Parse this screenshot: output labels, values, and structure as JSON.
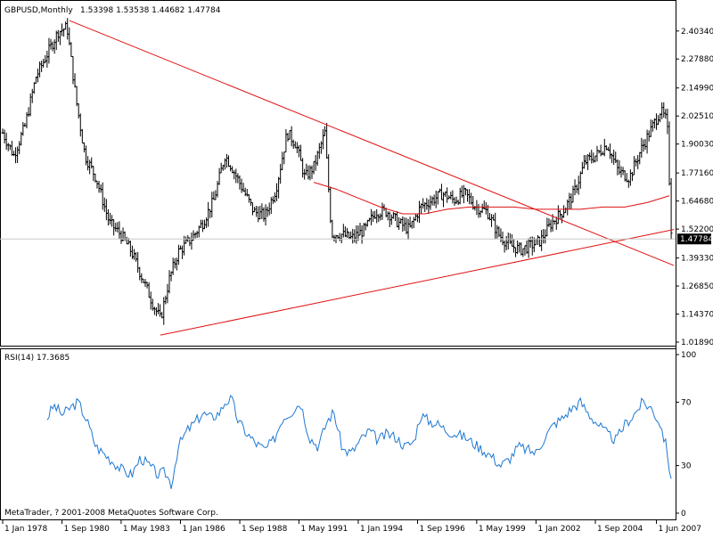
{
  "header": {
    "symbol": "GBPUSD,Monthly",
    "ohlc": "1.53398 1.53538 1.44682 1.47784"
  },
  "indicator": {
    "label": "RSI(14) 17.3685"
  },
  "footer": {
    "copyright": "MetaTrader, ? 2001-2008 MetaQuotes Software Corp."
  },
  "colors": {
    "bars": "#000000",
    "trendlines": "#e01010",
    "moving_average": "#e01010",
    "rsi_line": "#1e78d2",
    "last_price_box": "#000000"
  },
  "chart_data": [
    {
      "type": "ohlc",
      "series_name": "GBPUSD",
      "timeframe": "Monthly",
      "price_ticks": [
        "2.40340",
        "2.27880",
        "2.14990",
        "2.02510",
        "1.90030",
        "1.77160",
        "1.64680",
        "1.52200",
        "1.39330",
        "1.26850",
        "1.14370",
        "1.01890"
      ],
      "last_price": "1.47784",
      "ylim": [
        1.0189,
        2.47
      ],
      "x_ticks": [
        "1 Jan 1978",
        "1 Sep 1980",
        "1 May 1983",
        "1 Jan 1986",
        "1 Sep 1988",
        "1 May 1991",
        "1 Jan 1994",
        "1 Sep 1996",
        "1 May 1999",
        "1 Jan 2002",
        "1 Sep 2004",
        "1 Jun 2007"
      ],
      "x_tick_years": [
        1978.0,
        1980.67,
        1983.33,
        1986.0,
        1988.67,
        1991.33,
        1994.0,
        1996.67,
        1999.33,
        2002.0,
        2004.67,
        2007.42
      ],
      "xlim": [
        1978.0,
        2008.2
      ],
      "price_path": [
        [
          1978.0,
          1.95
        ],
        [
          1978.5,
          1.85
        ],
        [
          1979.0,
          1.98
        ],
        [
          1979.5,
          2.2
        ],
        [
          1980.0,
          2.3
        ],
        [
          1980.5,
          2.4
        ],
        [
          1980.9,
          2.42
        ],
        [
          1981.3,
          2.1
        ],
        [
          1981.7,
          1.85
        ],
        [
          1982.2,
          1.75
        ],
        [
          1982.8,
          1.55
        ],
        [
          1983.3,
          1.5
        ],
        [
          1983.8,
          1.42
        ],
        [
          1984.3,
          1.3
        ],
        [
          1984.8,
          1.18
        ],
        [
          1985.1,
          1.12
        ],
        [
          1985.5,
          1.3
        ],
        [
          1985.9,
          1.42
        ],
        [
          1986.5,
          1.48
        ],
        [
          1987.0,
          1.55
        ],
        [
          1987.5,
          1.65
        ],
        [
          1988.0,
          1.85
        ],
        [
          1988.3,
          1.8
        ],
        [
          1988.8,
          1.7
        ],
        [
          1989.3,
          1.6
        ],
        [
          1989.8,
          1.58
        ],
        [
          1990.3,
          1.7
        ],
        [
          1990.8,
          1.95
        ],
        [
          1991.2,
          1.9
        ],
        [
          1991.6,
          1.75
        ],
        [
          1992.0,
          1.8
        ],
        [
          1992.5,
          1.95
        ],
        [
          1992.8,
          1.5
        ],
        [
          1993.2,
          1.5
        ],
        [
          1993.7,
          1.48
        ],
        [
          1994.3,
          1.52
        ],
        [
          1994.8,
          1.6
        ],
        [
          1995.3,
          1.6
        ],
        [
          1995.8,
          1.55
        ],
        [
          1996.3,
          1.52
        ],
        [
          1996.8,
          1.62
        ],
        [
          1997.3,
          1.65
        ],
        [
          1997.8,
          1.68
        ],
        [
          1998.3,
          1.65
        ],
        [
          1998.8,
          1.68
        ],
        [
          1999.3,
          1.62
        ],
        [
          1999.8,
          1.6
        ],
        [
          2000.3,
          1.5
        ],
        [
          2000.8,
          1.45
        ],
        [
          2001.3,
          1.43
        ],
        [
          2001.8,
          1.45
        ],
        [
          2002.2,
          1.47
        ],
        [
          2002.7,
          1.55
        ],
        [
          2003.2,
          1.6
        ],
        [
          2003.7,
          1.68
        ],
        [
          2004.2,
          1.82
        ],
        [
          2004.7,
          1.85
        ],
        [
          2005.2,
          1.9
        ],
        [
          2005.7,
          1.78
        ],
        [
          2006.2,
          1.75
        ],
        [
          2006.7,
          1.87
        ],
        [
          2007.2,
          1.97
        ],
        [
          2007.6,
          2.05
        ],
        [
          2007.9,
          2.0
        ],
        [
          2008.1,
          1.48
        ]
      ],
      "moving_average": [
        [
          1992.0,
          1.73
        ],
        [
          1993.0,
          1.7
        ],
        [
          1994.0,
          1.66
        ],
        [
          1995.0,
          1.62
        ],
        [
          1996.0,
          1.59
        ],
        [
          1997.0,
          1.59
        ],
        [
          1998.0,
          1.61
        ],
        [
          1999.0,
          1.62
        ],
        [
          2000.0,
          1.62
        ],
        [
          2001.0,
          1.62
        ],
        [
          2002.0,
          1.61
        ],
        [
          2003.0,
          1.61
        ],
        [
          2004.0,
          1.61
        ],
        [
          2005.0,
          1.62
        ],
        [
          2006.0,
          1.62
        ],
        [
          2007.0,
          1.64
        ],
        [
          2008.0,
          1.67
        ]
      ],
      "trendlines": [
        {
          "from": [
            1981.0,
            2.45
          ],
          "to": [
            2008.2,
            1.36
          ]
        },
        {
          "from": [
            1985.1,
            1.05
          ],
          "to": [
            2008.2,
            1.52
          ]
        }
      ]
    },
    {
      "type": "line",
      "series_name": "RSI(14)",
      "y_ticks": [
        "100",
        "70",
        "30",
        "0"
      ],
      "ylim": [
        0,
        100
      ],
      "xlim": [
        1978.0,
        2008.2
      ],
      "values": [
        [
          1980.0,
          60
        ],
        [
          1980.3,
          68
        ],
        [
          1980.7,
          62
        ],
        [
          1981.0,
          66
        ],
        [
          1981.4,
          70
        ],
        [
          1981.8,
          58
        ],
        [
          1982.2,
          42
        ],
        [
          1982.6,
          37
        ],
        [
          1983.0,
          32
        ],
        [
          1983.4,
          27
        ],
        [
          1983.8,
          24
        ],
        [
          1984.2,
          35
        ],
        [
          1984.6,
          30
        ],
        [
          1985.0,
          24
        ],
        [
          1985.3,
          26
        ],
        [
          1985.6,
          18
        ],
        [
          1985.9,
          42
        ],
        [
          1986.3,
          52
        ],
        [
          1986.7,
          58
        ],
        [
          1987.0,
          63
        ],
        [
          1987.4,
          60
        ],
        [
          1987.8,
          64
        ],
        [
          1988.0,
          70
        ],
        [
          1988.3,
          72
        ],
        [
          1988.6,
          58
        ],
        [
          1989.0,
          50
        ],
        [
          1989.4,
          44
        ],
        [
          1989.8,
          40
        ],
        [
          1990.2,
          46
        ],
        [
          1990.6,
          60
        ],
        [
          1991.0,
          64
        ],
        [
          1991.4,
          70
        ],
        [
          1991.8,
          48
        ],
        [
          1992.2,
          42
        ],
        [
          1992.6,
          58
        ],
        [
          1992.9,
          64
        ],
        [
          1993.3,
          40
        ],
        [
          1993.7,
          38
        ],
        [
          1994.1,
          46
        ],
        [
          1994.5,
          52
        ],
        [
          1994.9,
          46
        ],
        [
          1995.3,
          50
        ],
        [
          1995.7,
          48
        ],
        [
          1996.1,
          42
        ],
        [
          1996.5,
          45
        ],
        [
          1996.8,
          62
        ],
        [
          1997.2,
          58
        ],
        [
          1997.6,
          56
        ],
        [
          1998.0,
          52
        ],
        [
          1998.4,
          50
        ],
        [
          1998.8,
          48
        ],
        [
          1999.2,
          44
        ],
        [
          1999.6,
          40
        ],
        [
          2000.0,
          36
        ],
        [
          2000.4,
          30
        ],
        [
          2000.8,
          34
        ],
        [
          2001.2,
          42
        ],
        [
          2001.6,
          40
        ],
        [
          2002.0,
          38
        ],
        [
          2002.4,
          48
        ],
        [
          2002.8,
          56
        ],
        [
          2003.2,
          60
        ],
        [
          2003.6,
          66
        ],
        [
          2004.0,
          70
        ],
        [
          2004.4,
          62
        ],
        [
          2004.8,
          56
        ],
        [
          2005.2,
          50
        ],
        [
          2005.6,
          46
        ],
        [
          2006.0,
          56
        ],
        [
          2006.4,
          62
        ],
        [
          2006.8,
          70
        ],
        [
          2007.2,
          66
        ],
        [
          2007.6,
          56
        ],
        [
          2007.9,
          40
        ],
        [
          2008.1,
          17
        ]
      ]
    }
  ]
}
